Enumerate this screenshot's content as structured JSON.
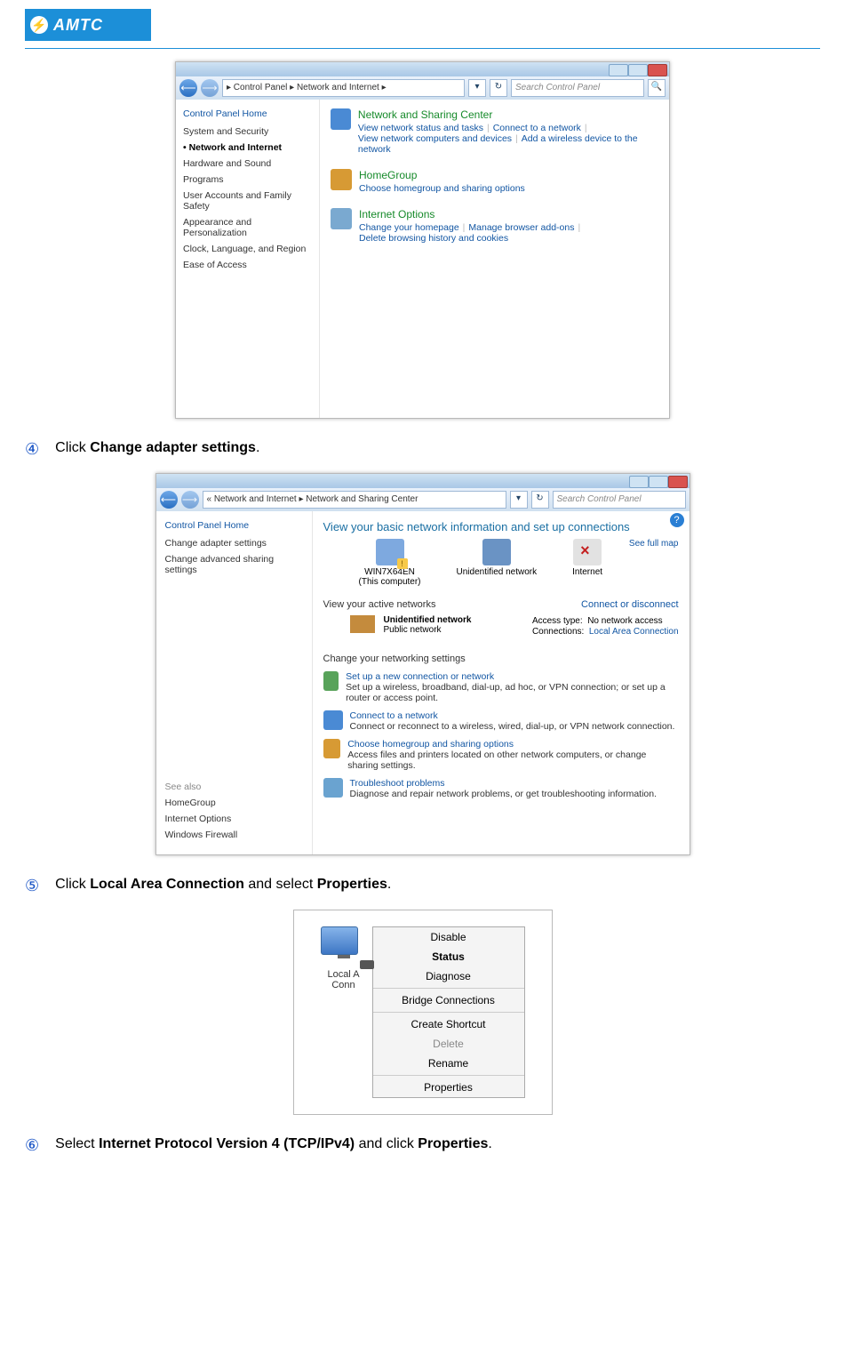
{
  "logo": {
    "text": "AMTC"
  },
  "fig1": {
    "path": "▸ Control Panel ▸ Network and Internet ▸",
    "search_ph": "Search Control Panel",
    "side_head": "Control Panel Home",
    "side_items": [
      "System and Security",
      "Network and Internet",
      "Hardware and Sound",
      "Programs",
      "User Accounts and Family Safety",
      "Appearance and Personalization",
      "Clock, Language, and Region",
      "Ease of Access"
    ],
    "grp": [
      {
        "title": "Network and Sharing Center",
        "line1a": "View network status and tasks",
        "line1b": "Connect to a network",
        "line2a": "View network computers and devices",
        "line2b": "Add a wireless device to the network",
        "color": "#4a8ad4"
      },
      {
        "title": "HomeGroup",
        "line1a": "Choose homegroup and sharing options",
        "color": "#d79a34"
      },
      {
        "title": "Internet Options",
        "line1a": "Change your homepage",
        "line1b": "Manage browser add-ons",
        "line2a": "Delete browsing history and cookies",
        "color": "#7aa9d0"
      }
    ]
  },
  "step4": {
    "num": "④",
    "pre": "Click ",
    "bold": "Change adapter settings",
    "post": "."
  },
  "fig2": {
    "path": "« Network and Internet ▸ Network and Sharing Center",
    "search_ph": "Search Control Panel",
    "side_head": "Control Panel Home",
    "side_items": [
      "Change adapter settings",
      "Change advanced sharing settings"
    ],
    "seealso": "See also",
    "seealso_items": [
      "HomeGroup",
      "Internet Options",
      "Windows Firewall"
    ],
    "main_title": "View your basic network information and set up connections",
    "fullmap": "See full map",
    "nodes": [
      {
        "name": "WIN7X64EN",
        "sub": "(This computer)"
      },
      {
        "name": "Unidentified network",
        "sub": ""
      },
      {
        "name": "Internet",
        "sub": ""
      }
    ],
    "active_hdr": "View your active networks",
    "connect_disc": "Connect or disconnect",
    "unet": "Unidentified network",
    "pubnet": "Public network",
    "access_lbl": "Access type:",
    "access_val": "No network access",
    "conn_lbl": "Connections:",
    "conn_val": "Local Area Connection",
    "change_hdr": "Change your networking settings",
    "opts": [
      {
        "t": "Set up a new connection or network",
        "s": "Set up a wireless, broadband, dial-up, ad hoc, or VPN connection; or set up a router or access point.",
        "c": "#58a35a"
      },
      {
        "t": "Connect to a network",
        "s": "Connect or reconnect to a wireless, wired, dial-up, or VPN network connection.",
        "c": "#4a8ad4"
      },
      {
        "t": "Choose homegroup and sharing options",
        "s": "Access files and printers located on other network computers, or change sharing settings.",
        "c": "#d79a34"
      },
      {
        "t": "Troubleshoot problems",
        "s": "Diagnose and repair network problems, or get troubleshooting information.",
        "c": "#6aa3d0"
      }
    ]
  },
  "step5": {
    "num": "⑤",
    "pre": "Click ",
    "bold1": "Local Area Connection",
    "mid": " and select ",
    "bold2": "Properties",
    "post": "."
  },
  "fig3": {
    "icon_line1": "Local A",
    "icon_line2": "Conn",
    "menu": [
      {
        "t": "Disable",
        "b": false,
        "d": false
      },
      {
        "t": "Status",
        "b": true,
        "d": false
      },
      {
        "t": "Diagnose",
        "b": false,
        "d": false
      },
      {
        "t": "---"
      },
      {
        "t": "Bridge Connections",
        "b": false,
        "d": false
      },
      {
        "t": "---"
      },
      {
        "t": "Create Shortcut",
        "b": false,
        "d": false
      },
      {
        "t": "Delete",
        "b": false,
        "d": true
      },
      {
        "t": "Rename",
        "b": false,
        "d": false
      },
      {
        "t": "---"
      },
      {
        "t": "Properties",
        "b": false,
        "d": false
      }
    ]
  },
  "step6": {
    "num": "⑥",
    "pre": "Select ",
    "bold1": "Internet Protocol Version 4 (TCP/IPv4)",
    "mid": " and click ",
    "bold2": "Properties",
    "post": "."
  }
}
